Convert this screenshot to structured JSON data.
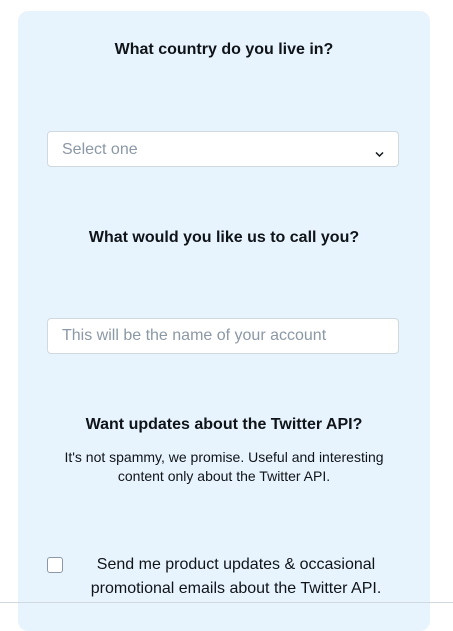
{
  "country_question": {
    "title": "What country do you live in?",
    "select_placeholder": "Select one",
    "icon": "chevron-down-icon"
  },
  "name_question": {
    "title": "What would you like us to call you?",
    "input_placeholder": "This will be the name of your account"
  },
  "updates_section": {
    "title": "Want updates about the Twitter API?",
    "description": "It's not spammy, we promise. Useful and interesting content only about the Twitter API.",
    "checkbox_label": "Send me product updates & occasional promotional emails about the Twitter API."
  },
  "colors": {
    "card_background": "#e8f4fd",
    "field_border": "#cfd9de",
    "placeholder_text": "#8b98a5",
    "primary_text": "#0f1419"
  }
}
